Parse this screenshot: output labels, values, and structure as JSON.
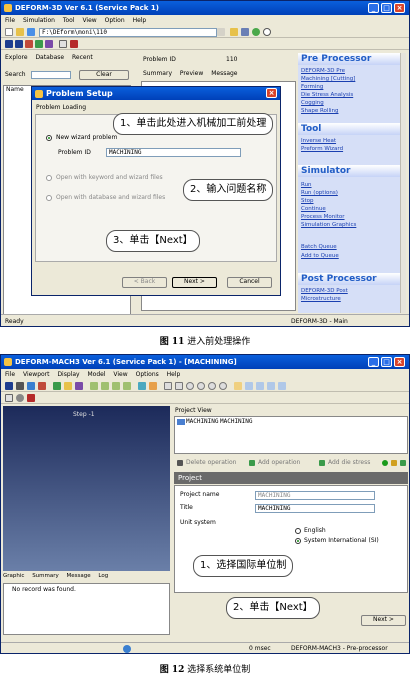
{
  "fig11": {
    "title": "DEFORM-3D  Ver 6.1 (Service Pack 1)",
    "menu": [
      "File",
      "Simulation",
      "Tool",
      "View",
      "Option",
      "Help"
    ],
    "path_value": "F:\\DEform\\moni\\110",
    "tabs": [
      "Explore",
      "Database",
      "Recent"
    ],
    "search_label": "Search",
    "clear_label": "Clear",
    "name_col": "Name",
    "problem_id_label": "Problem ID",
    "problem_id_value": "110",
    "subtabs": [
      "Summary",
      "Preview",
      "Message"
    ],
    "dialog": {
      "title": "Problem Setup",
      "section": "Problem Loading",
      "option1": "New wizard problem",
      "problem_id_label": "Problem ID",
      "problem_id_value": "MACHINING",
      "option2": "Open with keyword and wizard files",
      "option3": "Open with database and wizard files",
      "back_label": "< Back",
      "next_label": "Next >",
      "cancel_label": "Cancel"
    },
    "callouts": [
      "1、单击此处进入机械加工前处理",
      "2、输入问题名称",
      "3、单击【Next】"
    ],
    "panels": [
      {
        "header": "Pre Processor",
        "links": [
          "DEFORM-3D Pre",
          "Machining [Cutting]",
          "Forming",
          "Die Stress Analysis",
          "Cogging",
          "Shape Rolling"
        ]
      },
      {
        "header": "Tool",
        "links": [
          "Inverse Heat",
          "Preform Wizard"
        ]
      },
      {
        "header": "Simulator",
        "links": [
          "Run",
          "Run (options)",
          "Stop",
          "Continue",
          "Process Monitor",
          "Simulation Graphics",
          "Batch Queue",
          "Add to Queue"
        ]
      },
      {
        "header": "Post Processor",
        "links": [
          "DEFORM-3D Post",
          "Microstructure"
        ]
      }
    ],
    "status_left": "Ready",
    "status_right": "DEFORM-3D  -  Main",
    "caption_num": "图 11",
    "caption_text": "进入前处理操作"
  },
  "fig12": {
    "title": "DEFORM-MACH3  Ver 6.1 (Service Pack 1)  -  [MACHINING]",
    "menu": [
      "File",
      "Viewport",
      "Display",
      "Model",
      "View",
      "Options",
      "Help"
    ],
    "step_label": "Step -1",
    "bottom_tabs": [
      "Graphic",
      "Summary",
      "Message",
      "Log"
    ],
    "log_message": "No record was found.",
    "project_view_label": "Project View",
    "tree_items": [
      "MACHINING",
      "MACHINING"
    ],
    "delete_op": "Delete operation",
    "add_op": "Add operation",
    "add_die": "Add die stress",
    "section_header": "Project",
    "project_name_label": "Project name",
    "project_name_value": "MACHINING",
    "title_label": "Title",
    "title_value": "MACHINING",
    "unit_label": "Unit system",
    "unit_opt1": "English",
    "unit_opt2": "System International (SI)",
    "next_label": "Next >",
    "callouts": [
      "1、选择国际单位制",
      "2、单击【Next】"
    ],
    "status_time": "0 msec",
    "status_right": "DEFORM-MACH3  -  Pre-processor",
    "caption_num": "图 12",
    "caption_text": "选择系统单位制"
  }
}
